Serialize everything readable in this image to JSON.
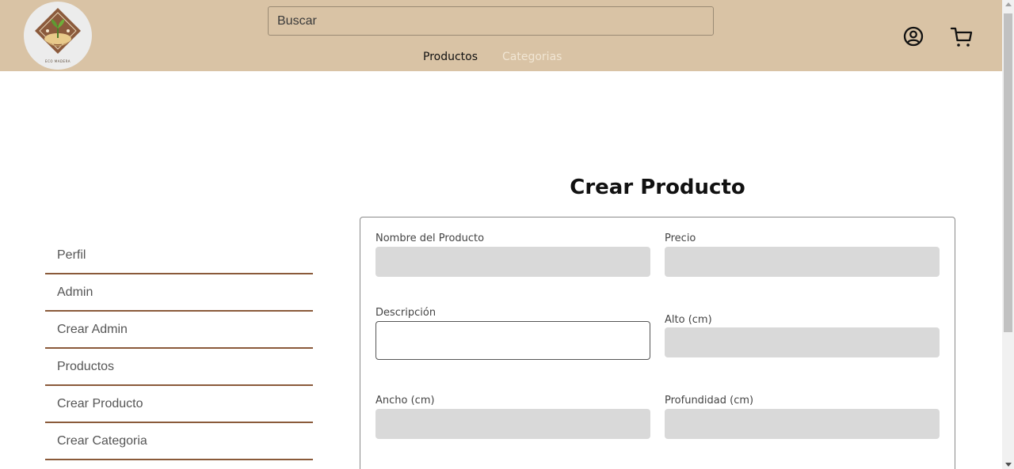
{
  "header": {
    "logo_text": "ECO MADERA",
    "search_placeholder": "Buscar",
    "nav": {
      "productos": "Productos",
      "categorias": "Categorias"
    },
    "icons": {
      "user": "user-circle-icon",
      "cart": "cart-icon"
    },
    "colors": {
      "background": "#d9c3a5",
      "nav_inactive": "#f1e6d4"
    }
  },
  "sidebar": {
    "items": [
      {
        "label": "Perfil"
      },
      {
        "label": "Admin"
      },
      {
        "label": "Crear Admin"
      },
      {
        "label": "Productos"
      },
      {
        "label": "Crear Producto"
      },
      {
        "label": "Crear Categoria"
      }
    ],
    "divider_color": "#8a5a3a"
  },
  "main": {
    "title": "Crear Producto",
    "fields": {
      "nombre": {
        "label": "Nombre del Producto",
        "value": ""
      },
      "precio": {
        "label": "Precio",
        "value": ""
      },
      "descripcion": {
        "label": "Descripción",
        "value": ""
      },
      "alto": {
        "label": "Alto (cm)",
        "value": ""
      },
      "ancho": {
        "label": "Ancho (cm)",
        "value": ""
      },
      "profundidad": {
        "label": "Profundidad (cm)",
        "value": ""
      }
    },
    "input_color": "#d9d9d9"
  }
}
